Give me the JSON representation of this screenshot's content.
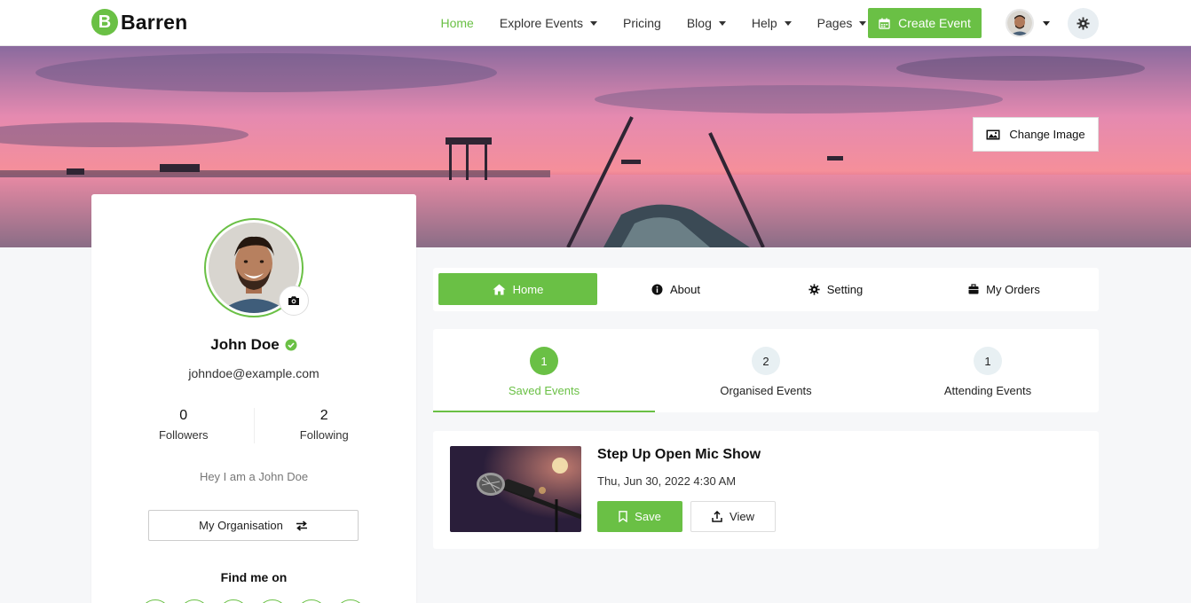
{
  "colors": {
    "accent": "#6ac045",
    "text": "#111111",
    "muted": "#777777",
    "page_bg": "#f6f7f9"
  },
  "header": {
    "logo_letter": "B",
    "logo_text": "Barren",
    "nav": [
      {
        "label": "Home",
        "active": true,
        "dropdown": false
      },
      {
        "label": "Explore Events",
        "active": false,
        "dropdown": true
      },
      {
        "label": "Pricing",
        "active": false,
        "dropdown": false
      },
      {
        "label": "Blog",
        "active": false,
        "dropdown": true
      },
      {
        "label": "Help",
        "active": false,
        "dropdown": true
      },
      {
        "label": "Pages",
        "active": false,
        "dropdown": true
      }
    ],
    "create_event_label": "Create Event",
    "create_event_icon": "calendar-icon",
    "theme_toggle_icon": "gear-icon"
  },
  "cover": {
    "change_image_label": "Change Image",
    "change_image_icon": "image-icon"
  },
  "profile": {
    "name": "John Doe",
    "verified_icon": "verified-check-icon",
    "email": "johndoe@example.com",
    "stats": [
      {
        "value": "0",
        "label": "Followers"
      },
      {
        "value": "2",
        "label": "Following"
      }
    ],
    "bio": "Hey I am a John Doe",
    "organisation_label": "My Organisation",
    "organisation_icon": "switch-arrows-icon",
    "find_me_label": "Find me on"
  },
  "tabs": [
    {
      "label": "Home",
      "icon": "home-icon",
      "active": true
    },
    {
      "label": "About",
      "icon": "info-icon",
      "active": false
    },
    {
      "label": "Setting",
      "icon": "gear-icon",
      "active": false
    },
    {
      "label": "My Orders",
      "icon": "briefcase-icon",
      "active": false
    }
  ],
  "events_summary": [
    {
      "count": "1",
      "label": "Saved Events",
      "active": true
    },
    {
      "count": "2",
      "label": "Organised Events",
      "active": false
    },
    {
      "count": "1",
      "label": "Attending Events",
      "active": false
    }
  ],
  "event": {
    "title": "Step Up Open Mic Show",
    "date": "Thu, Jun 30, 2022 4:30 AM",
    "save_label": "Save",
    "view_label": "View"
  }
}
